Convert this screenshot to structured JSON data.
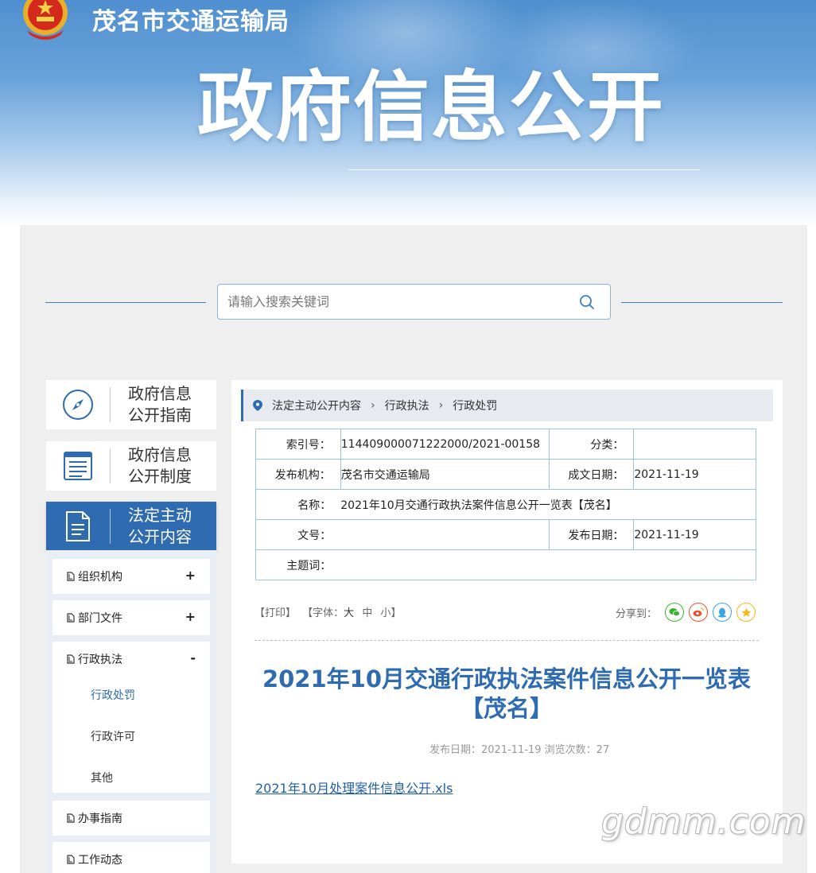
{
  "header": {
    "site_name": "茂名市交通运输局",
    "big_title": "政府信息公开"
  },
  "search": {
    "placeholder": "请输入搜索关键词"
  },
  "nav": {
    "items": [
      {
        "label": "政府信息公开指南",
        "icon": "compass-icon"
      },
      {
        "label": "政府信息公开制度",
        "icon": "list-document-icon"
      },
      {
        "label": "法定主动公开内容",
        "icon": "document-icon"
      }
    ],
    "sub": [
      {
        "label": "组织机构",
        "toggle": "+"
      },
      {
        "label": "部门文件",
        "toggle": "+"
      },
      {
        "label": "行政执法",
        "toggle": "-",
        "children": [
          "行政处罚",
          "行政许可",
          "其他"
        ]
      },
      {
        "label": "办事指南"
      },
      {
        "label": "工作动态"
      }
    ]
  },
  "breadcrumb": [
    "法定主动公开内容",
    "行政执法",
    "行政处罚"
  ],
  "meta": {
    "index_label": "索引号：",
    "index_value": "114409000071222000/2021-00158",
    "category_label": "分类：",
    "category_value": "",
    "publisher_label": "发布机构：",
    "publisher_value": "茂名市交通运输局",
    "created_label": "成文日期：",
    "created_value": "2021-11-19",
    "name_label": "名称：",
    "name_value": "2021年10月交通行政执法案件信息公开一览表【茂名】",
    "doc_no_label": "文号：",
    "doc_no_value": "",
    "pub_date_label": "发布日期：",
    "pub_date_value": "2021-11-19",
    "keywords_label": "主题词："
  },
  "tools": {
    "print": "【打印】",
    "font_label": "【字体：",
    "font_large": "大",
    "font_mid": "中",
    "font_small": "小】",
    "share_label": "分享到："
  },
  "article": {
    "title": "2021年10月交通行政执法案件信息公开一览表【茂名】",
    "info": "发布日期：2021-11-19  浏览次数：27",
    "attachment": "2021年10月处理案件信息公开.xls"
  },
  "watermark": "gdmm.com",
  "colors": {
    "primary": "#2e6bb0",
    "wechat": "#3eb135",
    "weibo": "#e6522c",
    "qq": "#3aa4e0",
    "qzone": "#f5b81c"
  }
}
